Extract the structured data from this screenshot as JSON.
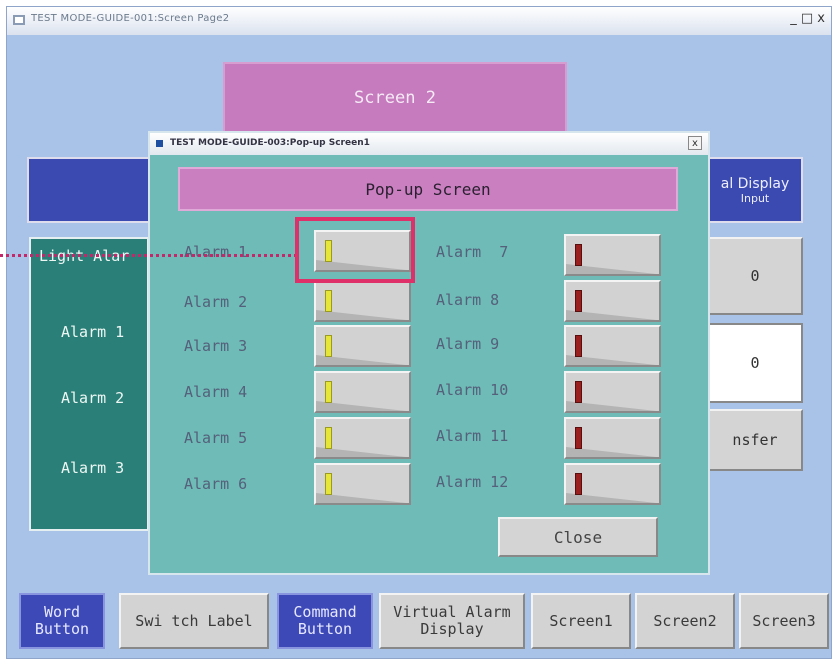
{
  "main_window": {
    "title": "TEST MODE-GUIDE-001:Screen Page2",
    "controls": "_ □ x"
  },
  "background": {
    "screen_label": "Screen 2",
    "right_header": [
      "al Display",
      "Input"
    ],
    "value_1": "0",
    "value_2": "0",
    "transfer_label": "nsfer",
    "left_panel": {
      "header": "Light Alar",
      "items": [
        "Alarm 1",
        "Alarm 2",
        "Alarm 3"
      ]
    }
  },
  "popup": {
    "title": "TEST MODE-GUIDE-003:Pop-up Screen1",
    "close_x": "x",
    "header": "Pop-up Screen",
    "alarms_left": [
      "Alarm 1",
      "Alarm 2",
      "Alarm 3",
      "Alarm 4",
      "Alarm 5",
      "Alarm 6"
    ],
    "alarms_right": [
      "Alarm  7",
      "Alarm 8",
      "Alarm 9",
      "Alarm 10",
      "Alarm 11",
      "Alarm 12"
    ],
    "lamp_color_left": "#e6e63a",
    "lamp_color_right": "#9a2020",
    "close_label": "Close"
  },
  "tabs": [
    {
      "label": "Word Button",
      "style": "blue"
    },
    {
      "label": "Swi tch Label",
      "style": "gray"
    },
    {
      "label": "Command Button",
      "style": "blue"
    },
    {
      "label": "Virtual Alarm Display",
      "style": "gray"
    },
    {
      "label": "Screen1",
      "style": "gray"
    },
    {
      "label": "Screen2",
      "style": "gray"
    },
    {
      "label": "Screen3",
      "style": "gray"
    }
  ],
  "highlight_color": "#e0306a"
}
